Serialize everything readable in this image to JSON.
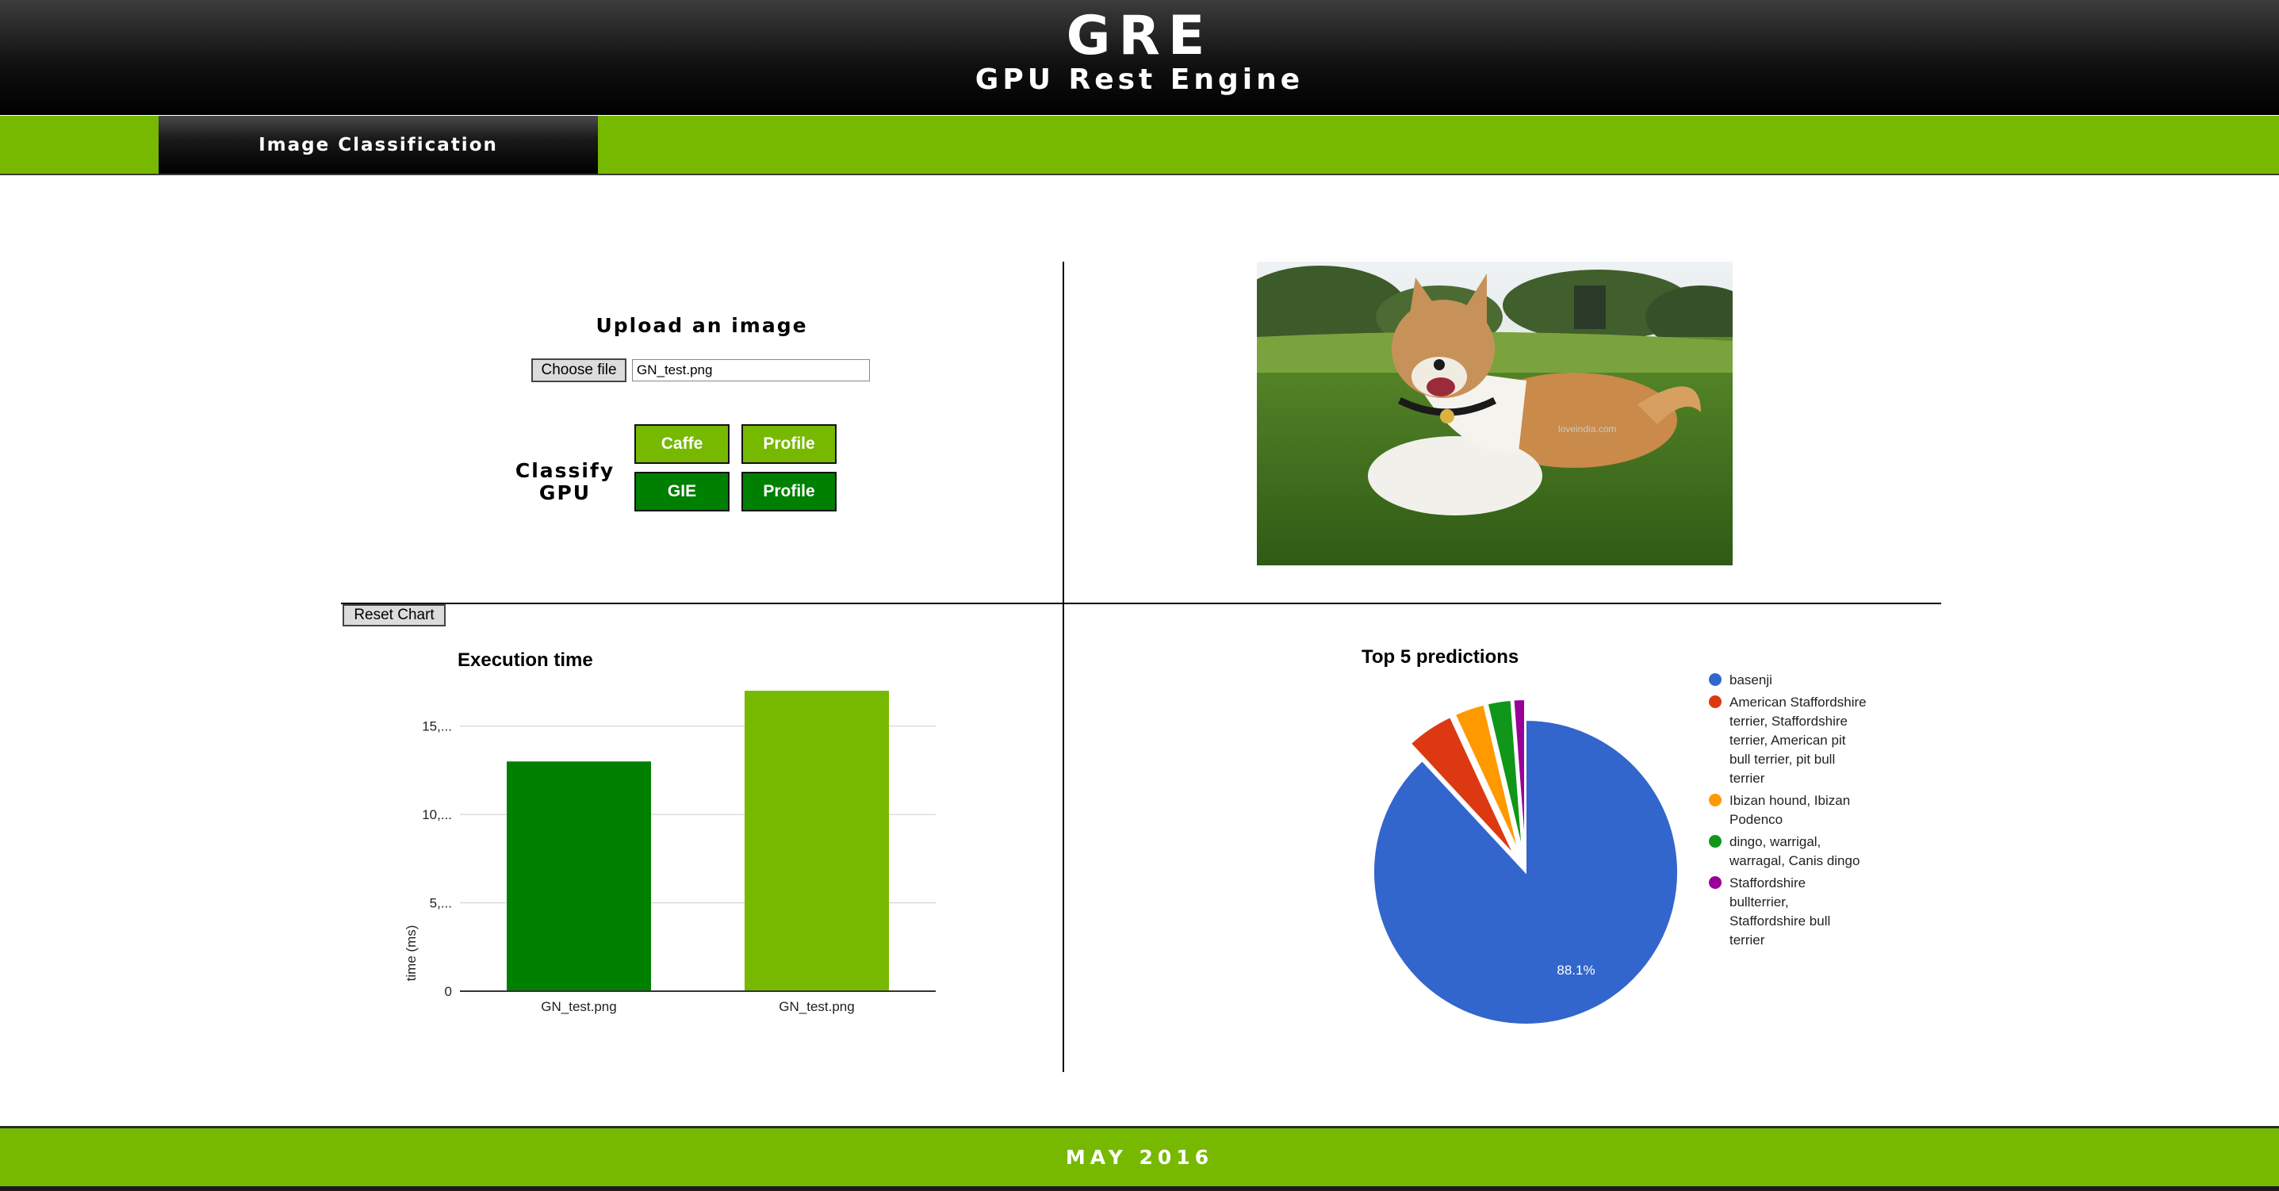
{
  "header": {
    "title": "GRE",
    "subtitle": "GPU Rest Engine"
  },
  "nav": {
    "tab_label": "Image Classification"
  },
  "upload": {
    "title": "Upload an image",
    "choose_label": "Choose file",
    "file_name": "GN_test.png"
  },
  "classify": {
    "label_line1": "Classify",
    "label_line2": "GPU",
    "caffe_label": "Caffe",
    "caffe_profile_label": "Profile",
    "gie_label": "GIE",
    "gie_profile_label": "Profile"
  },
  "photo": {
    "subject": "dog-on-grass-photo",
    "watermark": "loveindia.com"
  },
  "reset_label": "Reset Chart",
  "footer": {
    "text": "MAY 2016"
  },
  "colors": {
    "brand_green": "#76b900",
    "dark_green": "#008000",
    "pie": [
      "#3366cc",
      "#dc3912",
      "#ff9900",
      "#109618",
      "#990099"
    ]
  },
  "chart_data": [
    {
      "type": "bar",
      "title": "Execution time",
      "ylabel": "time (ms)",
      "xlabel": "",
      "categories": [
        "GN_test.png",
        "GN_test.png"
      ],
      "values": [
        13,
        17
      ],
      "bar_colors": [
        "#008000",
        "#76b900"
      ],
      "ylim": [
        0,
        17.5
      ],
      "yticks": [
        0,
        5,
        10,
        15
      ],
      "ytick_labels": [
        "0",
        "5,...",
        "10,...",
        "15,..."
      ],
      "grid": true,
      "legend": "none"
    },
    {
      "type": "pie",
      "title": "Top 5 predictions",
      "slices": [
        {
          "label": "basenji",
          "value": 88.1
        },
        {
          "label": "American Staffordshire terrier, Staffordshire terrier, American pit bull terrier, pit bull terrier",
          "value": 5.0
        },
        {
          "label": "Ibizan hound, Ibizan Podenco",
          "value": 3.2
        },
        {
          "label": "dingo, warrigal, warragal, Canis dingo",
          "value": 2.5
        },
        {
          "label": "Staffordshire bullterrier, Staffordshire bull terrier",
          "value": 1.2
        }
      ],
      "data_labels": [
        "88.1%"
      ],
      "legend": "right"
    }
  ]
}
